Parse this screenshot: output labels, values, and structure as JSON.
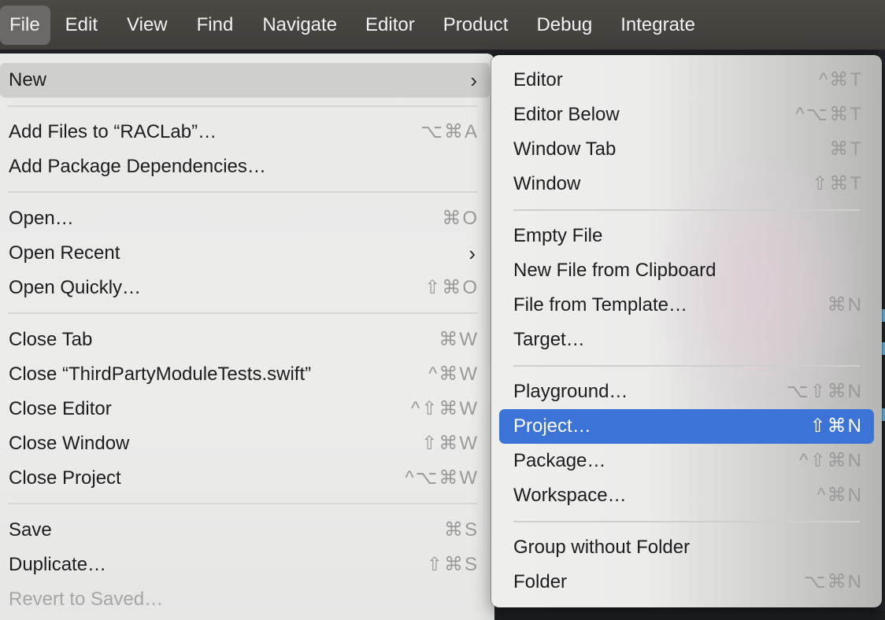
{
  "menubar": {
    "items": [
      "File",
      "Edit",
      "View",
      "Find",
      "Navigate",
      "Editor",
      "Product",
      "Debug",
      "Integrate"
    ]
  },
  "file_menu": {
    "items": [
      {
        "label": "New",
        "shortcut": "",
        "submenu": true
      },
      {
        "label": "Add Files to “RACLab”…",
        "shortcut": "⌥⌘A"
      },
      {
        "label": "Add Package Dependencies…",
        "shortcut": ""
      },
      {
        "label": "Open…",
        "shortcut": "⌘O"
      },
      {
        "label": "Open Recent",
        "shortcut": "",
        "submenu": true
      },
      {
        "label": "Open Quickly…",
        "shortcut": "⇧⌘O"
      },
      {
        "label": "Close Tab",
        "shortcut": "⌘W"
      },
      {
        "label": "Close “ThirdPartyModuleTests.swift”",
        "shortcut": "^⌘W"
      },
      {
        "label": "Close Editor",
        "shortcut": "^⇧⌘W"
      },
      {
        "label": "Close Window",
        "shortcut": "⇧⌘W"
      },
      {
        "label": "Close Project",
        "shortcut": "^⌥⌘W"
      },
      {
        "label": "Save",
        "shortcut": "⌘S"
      },
      {
        "label": "Duplicate…",
        "shortcut": "⇧⌘S"
      },
      {
        "label": "Revert to Saved…",
        "shortcut": "",
        "disabled": true
      }
    ]
  },
  "new_submenu": {
    "items": [
      {
        "label": "Editor",
        "shortcut": "^⌘T"
      },
      {
        "label": "Editor Below",
        "shortcut": "^⌥⌘T"
      },
      {
        "label": "Window Tab",
        "shortcut": "⌘T"
      },
      {
        "label": "Window",
        "shortcut": "⇧⌘T"
      },
      {
        "label": "Empty File",
        "shortcut": ""
      },
      {
        "label": "New File from Clipboard",
        "shortcut": ""
      },
      {
        "label": "File from Template…",
        "shortcut": "⌘N"
      },
      {
        "label": "Target…",
        "shortcut": ""
      },
      {
        "label": "Playground…",
        "shortcut": "⌥⇧⌘N"
      },
      {
        "label": "Project…",
        "shortcut": "⇧⌘N",
        "selected": true
      },
      {
        "label": "Package…",
        "shortcut": "^⇧⌘N"
      },
      {
        "label": "Workspace…",
        "shortcut": "^⌘N"
      },
      {
        "label": "Group without Folder",
        "shortcut": ""
      },
      {
        "label": "Folder",
        "shortcut": "⌥⌘N"
      }
    ]
  },
  "colors": {
    "selection": "#3b74d6",
    "menubar": "#42413d",
    "hover": "#cfcfcd"
  }
}
